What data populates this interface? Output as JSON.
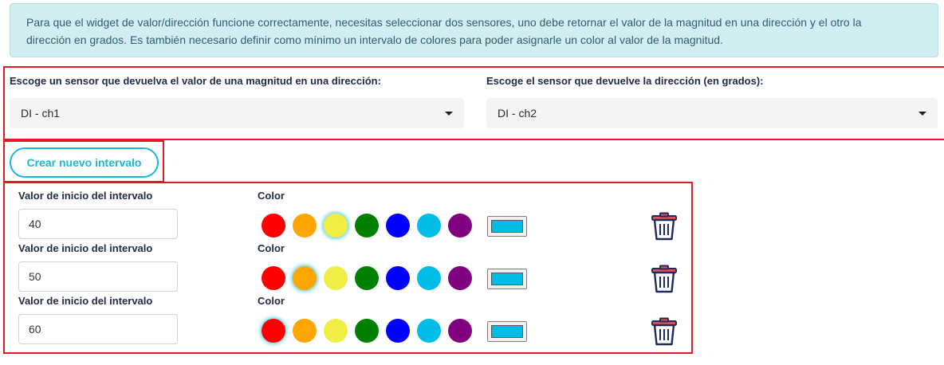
{
  "alert": {
    "line1": "Para que el widget de valor/dirección funcione correctamente, necesitas seleccionar dos sensores, uno debe retornar el valor de la magnitud en una dirección y el otro la",
    "line2": "dirección en grados. Es también necesario definir como mínimo un intervalo de colores para poder asignarle un color al valor de la magnitud."
  },
  "sensors": {
    "magnitude_label": "Escoge un sensor que devuelva el valor de una magnitud en una dirección:",
    "magnitude_value": "DI - ch1",
    "direction_label": "Escoge el sensor que devuelve la dirección (en grados):",
    "direction_value": "DI - ch2"
  },
  "new_interval_label": "Crear nuevo intervalo",
  "palette": [
    "#ff0000",
    "#ffa500",
    "#eeee44",
    "#008000",
    "#0000ff",
    "#00bde8",
    "#800080"
  ],
  "intervals": [
    {
      "start_label": "Valor de inicio del intervalo",
      "start_value": "40",
      "color_label": "Color",
      "selected_color": "#eeee44",
      "picker_color": "#00bde8"
    },
    {
      "start_label": "Valor de inicio del intervalo",
      "start_value": "50",
      "color_label": "Color",
      "selected_color": "#ffa500",
      "picker_color": "#00bde8"
    },
    {
      "start_label": "Valor de inicio del intervalo",
      "start_value": "60",
      "color_label": "Color",
      "selected_color": "#ff0000",
      "picker_color": "#00bde8"
    }
  ],
  "icons": {
    "delete": "trash-icon",
    "dropdown": "caret-down-icon"
  }
}
